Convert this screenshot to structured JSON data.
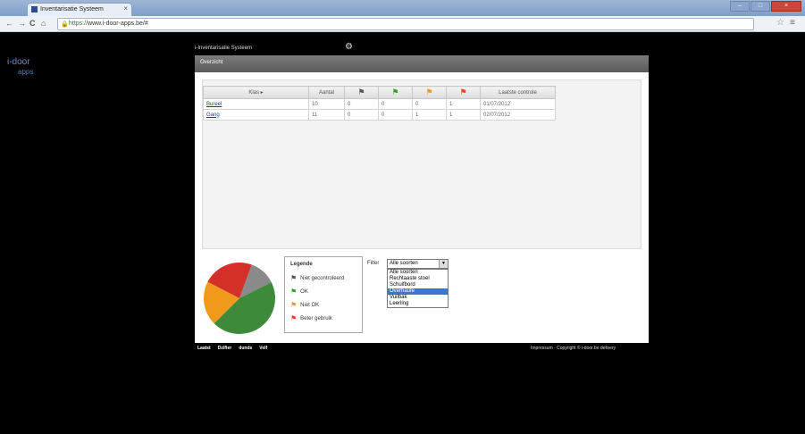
{
  "browser": {
    "tab_title": "Inventarisatie Systeem",
    "tab_close": "×",
    "url_scheme": "https://",
    "url_rest": "www.i-door-apps.be/#",
    "nav_back": "←",
    "nav_forward": "→",
    "nav_reload": "C",
    "nav_home": "⌂",
    "star": "☆",
    "menu": "≡"
  },
  "logo": {
    "line1": "i-door",
    "line2": "apps"
  },
  "app": {
    "title": "i-Inventarisatie Systeem",
    "settings_icon": "gear-icon",
    "panel_title": "Overzicht"
  },
  "table": {
    "headers": [
      "Klas ▸",
      "Aantal",
      "",
      "",
      "",
      "",
      "Laatste controle"
    ],
    "flag_colors": [
      "#555555",
      "#3a9a2a",
      "#f09a1a",
      "#e0442a"
    ],
    "rows": [
      {
        "klas": "Bureel",
        "aantal": "10",
        "f1": "0",
        "f2": "0",
        "f3": "0",
        "f4": "1",
        "date": "01/07/2012"
      },
      {
        "klas": "Gang",
        "aantal": "11",
        "f1": "0",
        "f2": "0",
        "f3": "1",
        "f4": "1",
        "date": "02/07/2012"
      }
    ]
  },
  "chart_data": {
    "type": "pie",
    "slices": [
      {
        "label": "Niet gecontroleerd",
        "value": 12,
        "color": "#8a8a8a"
      },
      {
        "label": "OK",
        "value": 45,
        "color": "#3f8a3a"
      },
      {
        "label": "Niet OK",
        "value": 20,
        "color": "#f09a1a"
      },
      {
        "label": "Beter gebruik",
        "value": 23,
        "color": "#d4302a"
      }
    ]
  },
  "legend": {
    "title": "Legende",
    "items": [
      {
        "label": "Niet gecontroleerd",
        "color": "#555555"
      },
      {
        "label": "OK",
        "color": "#3a9a2a"
      },
      {
        "label": "Niet OK",
        "color": "#f09a1a"
      },
      {
        "label": "Beter gebruik",
        "color": "#e0442a"
      }
    ]
  },
  "filter": {
    "label": "Filter",
    "selected": "Alle soorten",
    "options": [
      "Alle soorten",
      "Rechtaaste stoel",
      "Schuifbord",
      "Overhaufe",
      "Vuilbak",
      "Leerling"
    ],
    "highlighted_index": 3
  },
  "footer": {
    "links": [
      "Laatst",
      "Dzifter",
      "dunds",
      "Velf"
    ],
    "right_text": "Impressum · Copyright © i-door.be delivery"
  }
}
